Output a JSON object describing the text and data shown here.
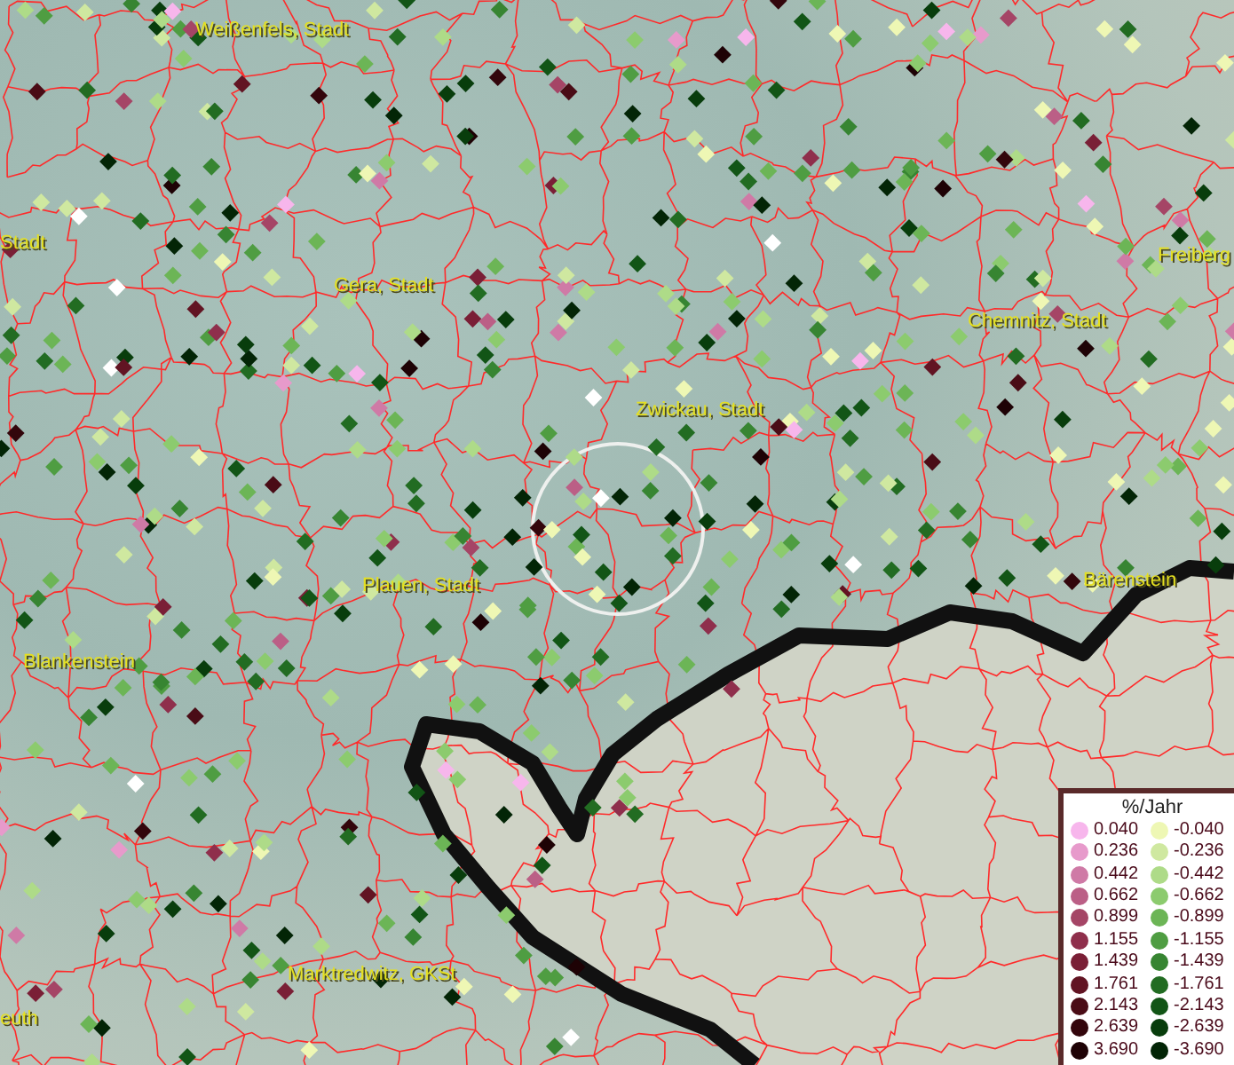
{
  "map": {
    "labels": [
      {
        "text": "Weißenfels, Stadt"
      },
      {
        "text": "Stadt"
      },
      {
        "text": "Gera, Stadt"
      },
      {
        "text": "Chemnitz, Stadt"
      },
      {
        "text": "Freiberg"
      },
      {
        "text": "Zwickau, Stadt"
      },
      {
        "text": "Plauen, Stadt"
      },
      {
        "text": "Bärenstein"
      },
      {
        "text": "Blankenstein"
      },
      {
        "text": "Marktredwitz, GKSt"
      },
      {
        "text": "euth"
      }
    ]
  },
  "legend": {
    "title": "%/Jahr",
    "positive": [
      {
        "label": "0.040",
        "color": "#f7b6ec"
      },
      {
        "label": "0.236",
        "color": "#e79acb"
      },
      {
        "label": "0.442",
        "color": "#cf7aa6"
      },
      {
        "label": "0.662",
        "color": "#bb5f86"
      },
      {
        "label": "0.899",
        "color": "#a54566"
      },
      {
        "label": "1.155",
        "color": "#8f2f4c"
      },
      {
        "label": "1.439",
        "color": "#7a1f36"
      },
      {
        "label": "1.761",
        "color": "#621423"
      },
      {
        "label": "2.143",
        "color": "#4a0c16"
      },
      {
        "label": "2.639",
        "color": "#33060c"
      },
      {
        "label": "3.690",
        "color": "#1e0205"
      }
    ],
    "negative": [
      {
        "label": "-0.040",
        "color": "#eef7b4"
      },
      {
        "label": "-0.236",
        "color": "#cfe8a0"
      },
      {
        "label": "-0.442",
        "color": "#aedb88"
      },
      {
        "label": "-0.662",
        "color": "#8ccb6e"
      },
      {
        "label": "-0.899",
        "color": "#6cb556"
      },
      {
        "label": "-1.155",
        "color": "#4f9d42"
      },
      {
        "label": "-1.439",
        "color": "#378532"
      },
      {
        "label": "-1.761",
        "color": "#226c22"
      },
      {
        "label": "-2.143",
        "color": "#125516"
      },
      {
        "label": "-2.639",
        "color": "#083d0c"
      },
      {
        "label": "-3.690",
        "color": "#032506"
      }
    ]
  }
}
